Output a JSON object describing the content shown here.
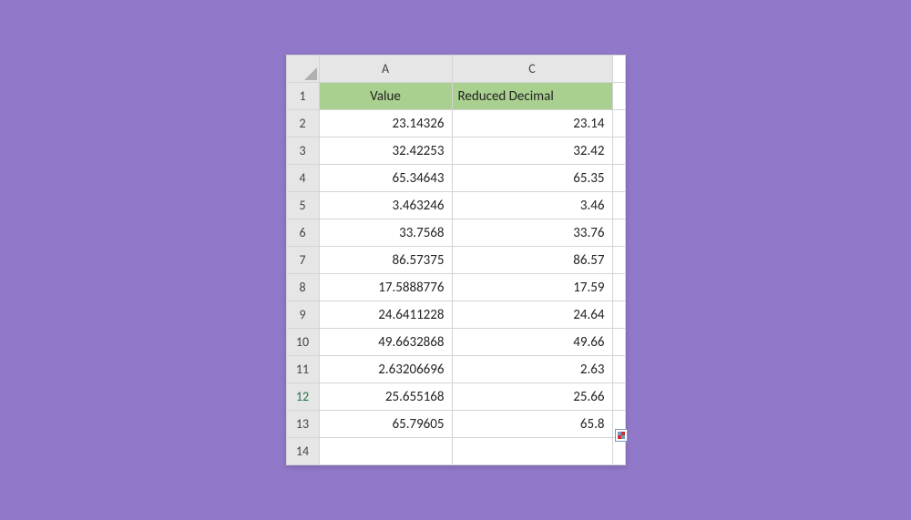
{
  "columns": {
    "A": "A",
    "C": "C"
  },
  "headers": {
    "value": "Value",
    "reduced": "Reduced Decimal"
  },
  "active_row": 12,
  "rows": [
    {
      "n": 1
    },
    {
      "n": 2,
      "value": "23.14326",
      "reduced": "23.14"
    },
    {
      "n": 3,
      "value": "32.42253",
      "reduced": "32.42"
    },
    {
      "n": 4,
      "value": "65.34643",
      "reduced": "65.35"
    },
    {
      "n": 5,
      "value": "3.463246",
      "reduced": "3.46"
    },
    {
      "n": 6,
      "value": "33.7568",
      "reduced": "33.76"
    },
    {
      "n": 7,
      "value": "86.57375",
      "reduced": "86.57"
    },
    {
      "n": 8,
      "value": "17.5888776",
      "reduced": "17.59"
    },
    {
      "n": 9,
      "value": "24.6411228",
      "reduced": "24.64"
    },
    {
      "n": 10,
      "value": "49.6632868",
      "reduced": "49.66"
    },
    {
      "n": 11,
      "value": "2.63206696",
      "reduced": "2.63"
    },
    {
      "n": 12,
      "value": "25.655168",
      "reduced": "25.66"
    },
    {
      "n": 13,
      "value": "65.79605",
      "reduced": "65.8"
    },
    {
      "n": 14
    }
  ],
  "chart_data": {
    "type": "table",
    "columns": [
      "Value",
      "Reduced Decimal"
    ],
    "rows": [
      [
        23.14326,
        23.14
      ],
      [
        32.42253,
        32.42
      ],
      [
        65.34643,
        65.35
      ],
      [
        3.463246,
        3.46
      ],
      [
        33.7568,
        33.76
      ],
      [
        86.57375,
        86.57
      ],
      [
        17.5888776,
        17.59
      ],
      [
        24.6411228,
        24.64
      ],
      [
        49.6632868,
        49.66
      ],
      [
        2.63206696,
        2.63
      ],
      [
        25.655168,
        25.66
      ],
      [
        65.79605,
        65.8
      ]
    ]
  }
}
